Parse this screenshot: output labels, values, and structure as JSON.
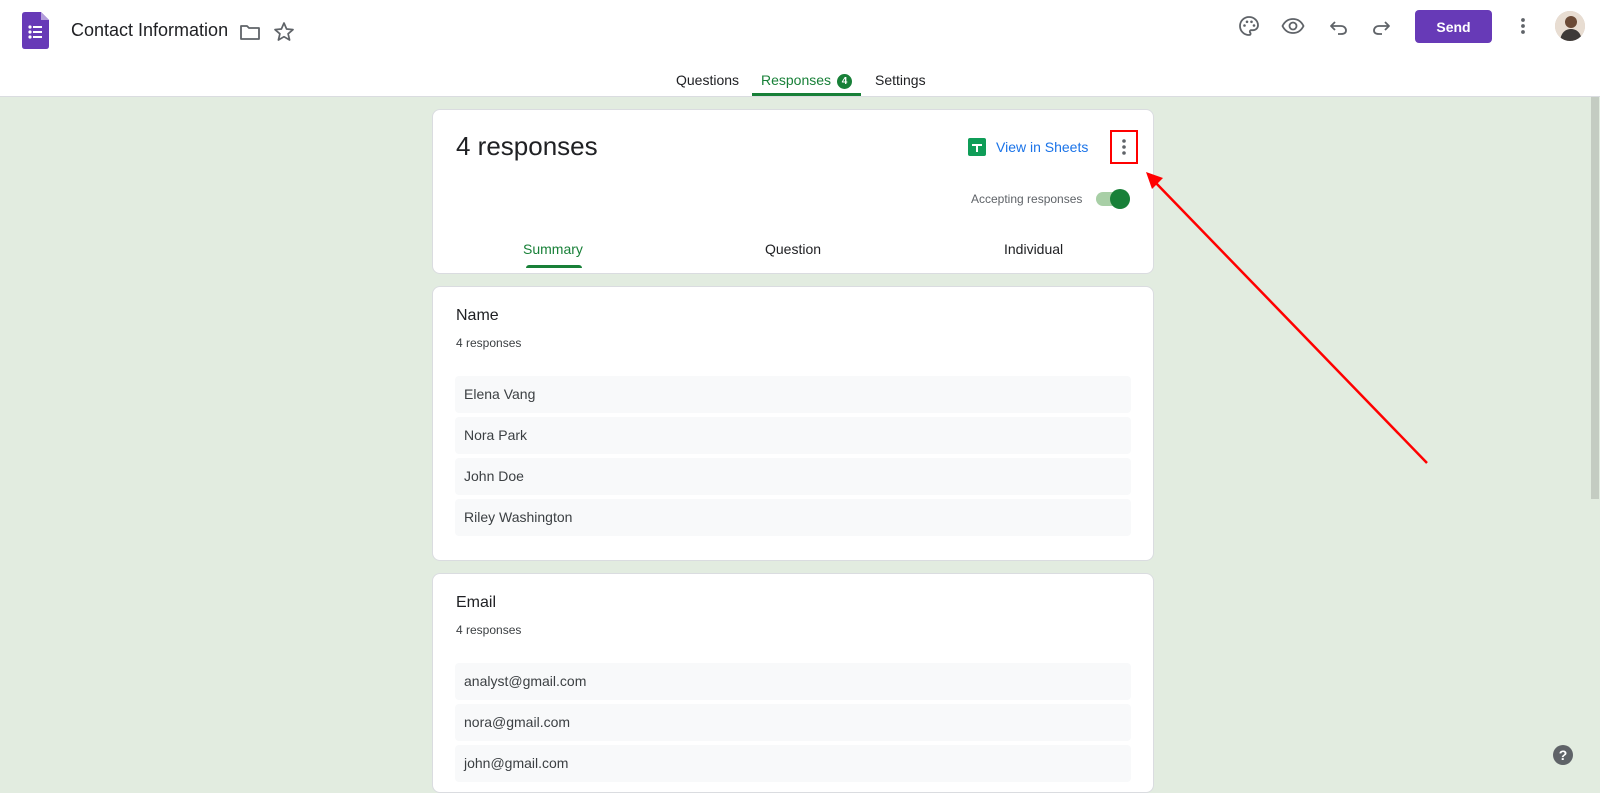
{
  "app": {
    "title": "Contact Information",
    "icons": {
      "logo": "google-forms-icon",
      "folder": "folder-icon",
      "star": "star-icon",
      "palette": "palette-icon",
      "preview": "eye-icon",
      "undo": "undo-icon",
      "redo": "redo-icon",
      "more": "more-vert-icon"
    },
    "send_label": "Send",
    "accent_color": "#673ab7"
  },
  "tabs": [
    {
      "label": "Questions"
    },
    {
      "label": "Responses",
      "badge": "4"
    },
    {
      "label": "Settings"
    }
  ],
  "responses_header": {
    "count_label": "4 responses",
    "view_in_sheets_label": "View in Sheets",
    "accepting_label": "Accepting responses",
    "accepting": true,
    "sub_tabs": [
      {
        "label": "Summary"
      },
      {
        "label": "Question"
      },
      {
        "label": "Individual"
      }
    ]
  },
  "questions": [
    {
      "title": "Name",
      "count_label": "4 responses",
      "answers": [
        "Elena Vang",
        "Nora Park",
        "John Doe",
        "Riley Washington"
      ]
    },
    {
      "title": "Email",
      "count_label": "4 responses",
      "answers": [
        "analyst@gmail.com",
        "nora@gmail.com",
        "john@gmail.com"
      ]
    }
  ],
  "help_label": "?",
  "colors": {
    "brand_green": "#188038",
    "background": "#e2ece0",
    "annotation_red": "#ff0000"
  }
}
